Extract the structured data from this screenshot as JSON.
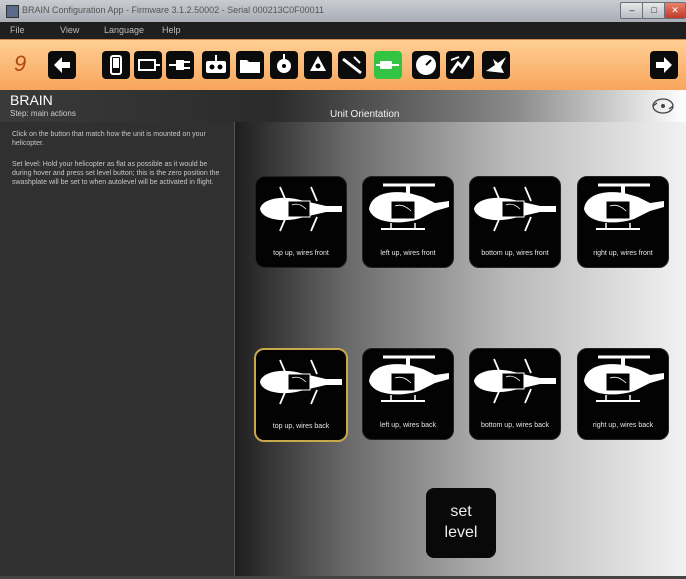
{
  "window": {
    "title": "BRAIN Configuration App - Firmware 3.1.2.50002 - Serial 000213C0F00011",
    "minimize": "–",
    "maximize": "□",
    "close": "✕"
  },
  "menu": [
    "File",
    "View",
    "Language",
    "Help"
  ],
  "toolbar": {
    "step": "9",
    "buttons": [
      "back-arrow-icon",
      "phone-icon",
      "servo-icon",
      "plug-icon",
      "transmitter-icon",
      "folder-icon",
      "swashplate-icon",
      "rotor-head-icon",
      "tail-icon",
      "orientation-icon",
      "gauge-icon",
      "governor-icon",
      "heli-flight-icon",
      "forward-arrow-icon"
    ],
    "active": "orientation-icon"
  },
  "header": {
    "brand": "BRAIN",
    "subtitle": "Step: main actions",
    "section_title": "Unit Orientation"
  },
  "instructions": {
    "p1": "Click on the button that match how the unit is mounted on your helicopter.",
    "p2": "Set level: Hold your helicopter as flat as possible as it would be during hover and press set level button; this is the zero position the swashplate will be set to when autolevel will be activated in flight."
  },
  "orientations": [
    {
      "label": "top up, wires front",
      "view": "top",
      "selected": false
    },
    {
      "label": "left up, wires front",
      "view": "side",
      "selected": false
    },
    {
      "label": "bottom up, wires front",
      "view": "top",
      "selected": false
    },
    {
      "label": "right up, wires front",
      "view": "side",
      "selected": false
    },
    {
      "label": "top up, wires back",
      "view": "top",
      "selected": true
    },
    {
      "label": "left up, wires back",
      "view": "side",
      "selected": false
    },
    {
      "label": "bottom up, wires back",
      "view": "top",
      "selected": false
    },
    {
      "label": "right up, wires back",
      "view": "side",
      "selected": false
    }
  ],
  "set_level": {
    "line1": "set",
    "line2": "level"
  },
  "colors": {
    "toolbar": "#f9a55b",
    "active_icon": "#33c443",
    "selected_border": "#c8a84a"
  }
}
